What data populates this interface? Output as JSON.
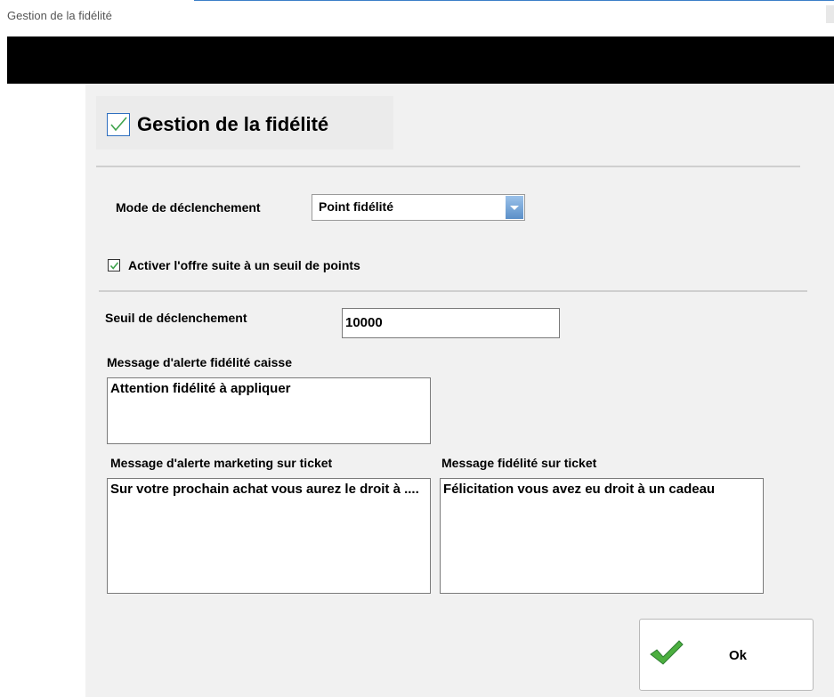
{
  "window": {
    "title": "Gestion de la fidélité"
  },
  "header": {
    "title": "Gestion de la fidélité",
    "enabled": true
  },
  "mode": {
    "label": "Mode de déclenchement",
    "selected": "Point fidélité"
  },
  "threshold_toggle": {
    "label": "Activer l'offre suite à un seuil de points",
    "checked": true
  },
  "threshold": {
    "label": "Seuil de déclenchement",
    "value": "10000"
  },
  "alert_caisse": {
    "label": "Message d'alerte fidélité caisse",
    "value": "Attention fidélité à appliquer"
  },
  "alert_marketing": {
    "label": "Message d'alerte marketing sur ticket",
    "value": "Sur votre prochain achat vous aurez le droit à ...."
  },
  "ticket_message": {
    "label": "Message fidélité sur ticket",
    "value": "Félicitation vous avez eu droit à un cadeau"
  },
  "ok_button": {
    "label": "Ok",
    "icon": "checkmark-icon"
  },
  "colors": {
    "accent": "#2e6fbf",
    "check_green": "#3fa34d",
    "background": "#f1f1f1"
  }
}
